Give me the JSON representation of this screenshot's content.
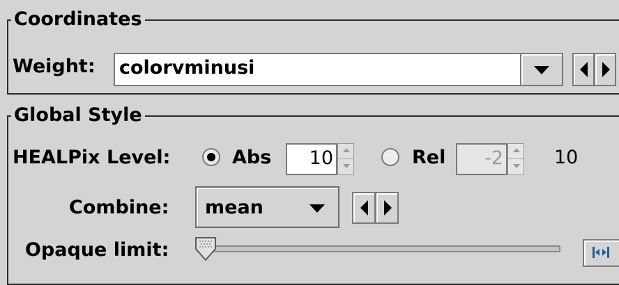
{
  "coordinates": {
    "legend": "Coordinates",
    "weight_label": "Weight:",
    "weight_value": "colorvminusi"
  },
  "global_style": {
    "legend": "Global Style",
    "healpix_label": "HEALPix Level:",
    "abs_label": "Abs",
    "abs_value": "10",
    "abs_selected": true,
    "rel_label": "Rel",
    "rel_value": "-2",
    "rel_selected": false,
    "level_readout": "10",
    "combine_label": "Combine:",
    "combine_value": "mean",
    "opaque_label": "Opaque limit:",
    "opaque_level": 0
  }
}
